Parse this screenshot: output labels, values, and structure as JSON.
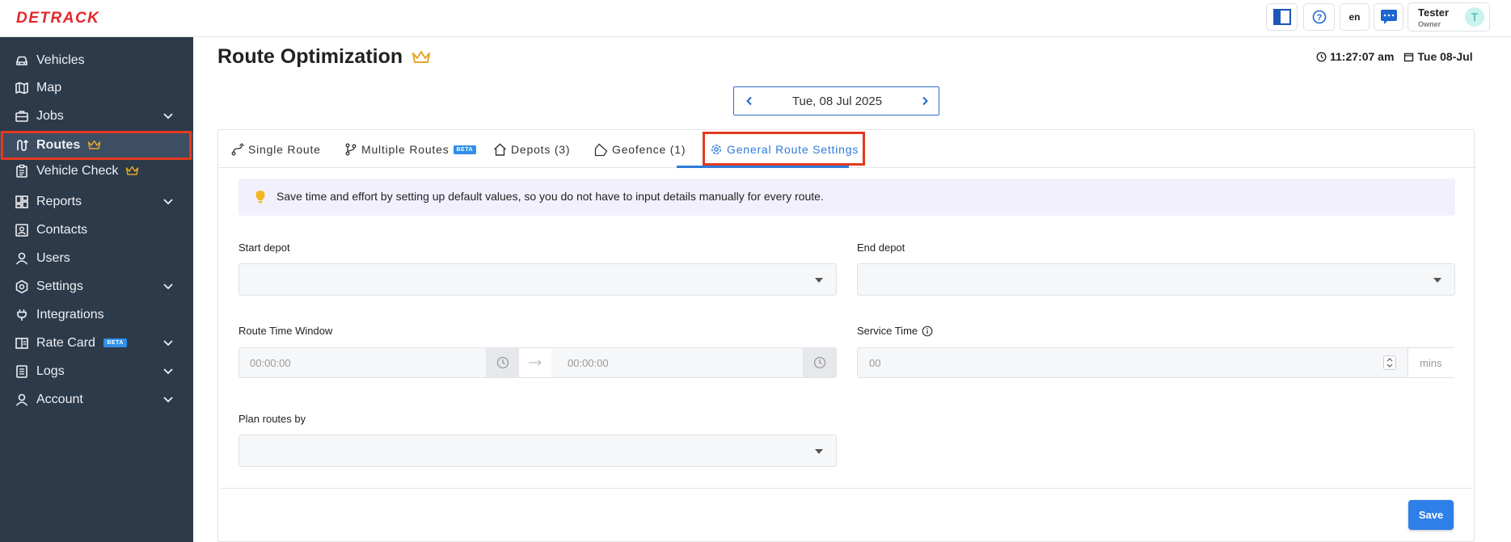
{
  "brand": {
    "logo_text": "DETRACK"
  },
  "header": {
    "lang": "en",
    "user_name": "Tester",
    "user_role": "Owner",
    "avatar_initial": "T"
  },
  "sidebar": {
    "items": [
      {
        "label": "Vehicles",
        "icon": "car-icon"
      },
      {
        "label": "Map",
        "icon": "map-icon"
      },
      {
        "label": "Jobs",
        "icon": "briefcase-icon"
      },
      {
        "label": "Routes",
        "icon": "route-icon"
      },
      {
        "label": "Vehicle Check",
        "icon": "clipboard-icon"
      },
      {
        "label": "Reports",
        "icon": "dashboard-icon"
      },
      {
        "label": "Contacts",
        "icon": "contact-card-icon"
      },
      {
        "label": "Users",
        "icon": "user-icon"
      },
      {
        "label": "Settings",
        "icon": "gear-icon"
      },
      {
        "label": "Integrations",
        "icon": "plug-icon"
      },
      {
        "label": "Rate Card",
        "icon": "rate-card-icon"
      },
      {
        "label": "Logs",
        "icon": "log-icon"
      },
      {
        "label": "Account",
        "icon": "account-icon"
      }
    ],
    "beta_label": "BETA"
  },
  "page": {
    "title": "Route Optimization",
    "time": "11:27:07 am",
    "date": "Tue 08-Jul",
    "nav_date": "Tue, 08 Jul 2025"
  },
  "tabs": [
    {
      "label": "Single Route"
    },
    {
      "label": "Multiple Routes",
      "badge": "BETA"
    },
    {
      "label": "Depots (3)"
    },
    {
      "label": "Geofence (1)"
    },
    {
      "label": "General Route Settings"
    }
  ],
  "info": {
    "text": "Save time and effort by setting up default values, so you do not have to input details manually for every route."
  },
  "form": {
    "start_depot_label": "Start depot",
    "end_depot_label": "End depot",
    "route_time_window_label": "Route Time Window",
    "time_start_placeholder": "00:00:00",
    "time_end_placeholder": "00:00:00",
    "service_time_label": "Service Time",
    "service_time_placeholder": "00",
    "service_time_unit": "mins",
    "plan_routes_by_label": "Plan routes by"
  },
  "actions": {
    "save_label": "Save"
  },
  "colors": {
    "accent": "#2f7bd9",
    "sidebar": "#2d3a4a",
    "highlight": "#e33a1f",
    "brand": "#e5262b"
  }
}
